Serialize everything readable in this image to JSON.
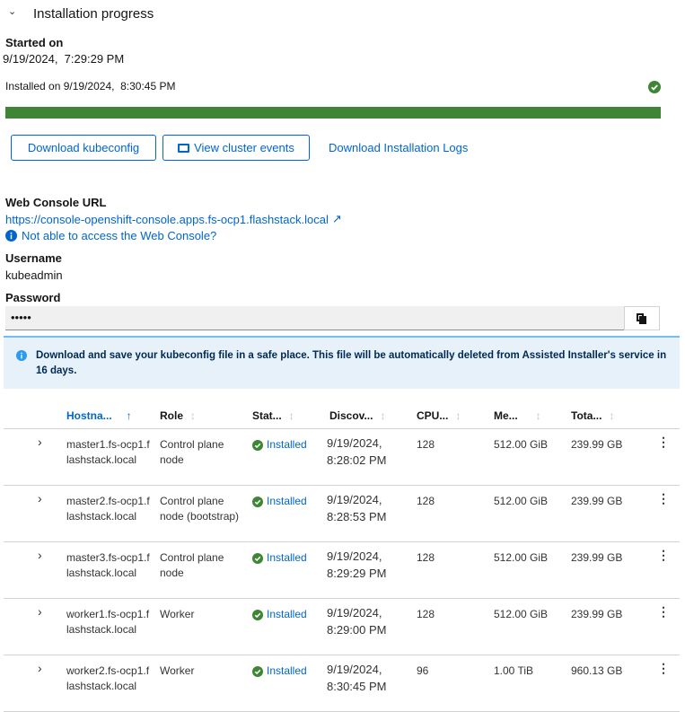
{
  "section": {
    "title": "Installation progress"
  },
  "started": {
    "label": "Started on",
    "value": "9/19/2024,  7:29:29 PM"
  },
  "installed": {
    "label": "Installed on",
    "value": "9/19/2024,  8:30:45 PM"
  },
  "progress": {
    "percent": 100,
    "color": "#3e8635"
  },
  "buttons": {
    "kubeconfig": "Download kubeconfig",
    "events": "View cluster events",
    "logs": "Download Installation Logs"
  },
  "console": {
    "label": "Web Console URL",
    "url": "https://console-openshift-console.apps.fs-ocp1.flashstack.local",
    "help": "Not able to access the Web Console?"
  },
  "username": {
    "label": "Username",
    "value": "kubeadmin"
  },
  "password": {
    "label": "Password",
    "value": "•••••"
  },
  "alert": {
    "text": "Download and save your kubeconfig file in a safe place. This file will be automatically deleted from Assisted Installer's service in 16 days."
  },
  "table": {
    "headers": [
      "Hostna...",
      "Role",
      "Stat...",
      "Discov...",
      "CPU...",
      "Me...",
      "Tota..."
    ],
    "rows": [
      {
        "host": "master1.fs-ocp1.flashstack.local",
        "role": "Control plane node",
        "status": "Installed",
        "date": "9/19/2024,",
        "time": "8:28:02 PM",
        "cpu": "128",
        "mem": "512.00 GiB",
        "total": "239.99 GB"
      },
      {
        "host": "master2.fs-ocp1.flashstack.local",
        "role": "Control plane node (bootstrap)",
        "status": "Installed",
        "date": "9/19/2024,",
        "time": "8:28:53 PM",
        "cpu": "128",
        "mem": "512.00 GiB",
        "total": "239.99 GB"
      },
      {
        "host": "master3.fs-ocp1.flashstack.local",
        "role": "Control plane node",
        "status": "Installed",
        "date": "9/19/2024,",
        "time": "8:29:29 PM",
        "cpu": "128",
        "mem": "512.00 GiB",
        "total": "239.99 GB"
      },
      {
        "host": "worker1.fs-ocp1.flashstack.local",
        "role": "Worker",
        "status": "Installed",
        "date": "9/19/2024,",
        "time": "8:29:00 PM",
        "cpu": "128",
        "mem": "512.00 GiB",
        "total": "239.99 GB"
      },
      {
        "host": "worker2.fs-ocp1.flashstack.local",
        "role": "Worker",
        "status": "Installed",
        "date": "9/19/2024,",
        "time": "8:30:45 PM",
        "cpu": "96",
        "mem": "1.00 TiB",
        "total": "960.13 GB"
      }
    ]
  }
}
